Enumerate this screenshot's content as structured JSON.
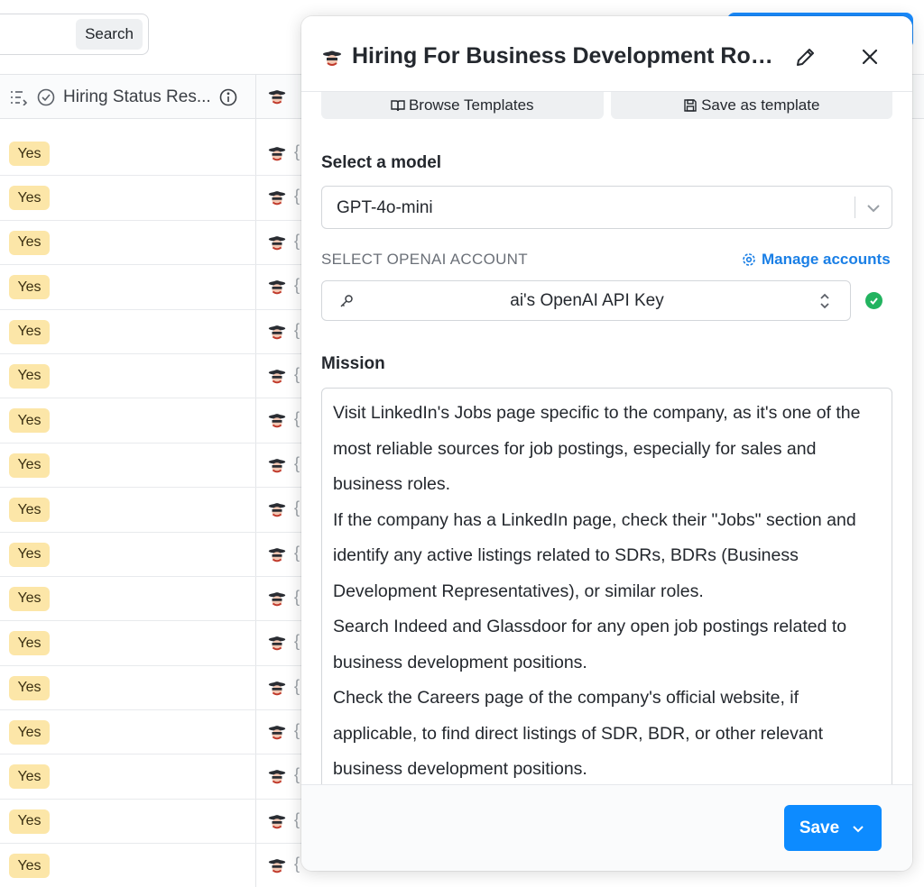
{
  "background": {
    "search_button_label": "Search",
    "column1_header": "Hiring Status Res...",
    "rows": [
      "Yes",
      "Yes",
      "Yes",
      "Yes",
      "Yes",
      "Yes",
      "Yes",
      "Yes",
      "Yes",
      "Yes",
      "Yes",
      "Yes",
      "Yes",
      "Yes",
      "Yes",
      "Yes",
      "Yes"
    ],
    "row_brace": "{",
    "colors": {
      "yes_badge_bg": "#fce6a8",
      "accent": "#1a8cff"
    }
  },
  "panel": {
    "title": "Hiring For Business Development Roles",
    "title_icon": "spy-agent-icon",
    "browse_templates_label": "Browse Templates",
    "save_template_label": "Save as template",
    "model_label": "Select a model",
    "model_value": "GPT-4o-mini",
    "account_label": "SELECT OPENAI ACCOUNT",
    "manage_accounts_label": "Manage accounts",
    "account_value": "ai's OpenAI API Key",
    "mission_label": "Mission",
    "mission_paragraphs": [
      "Visit LinkedIn's Jobs page specific to the company, as it's one of the most reliable sources for job postings, especially for sales and business roles.",
      "If the company has a LinkedIn page, check their \"Jobs\" section and identify any active listings related to SDRs, BDRs (Business Development Representatives), or similar roles.",
      "Search Indeed and Glassdoor for any open job postings related to business development positions.",
      "Check the Careers page of the company's official website, if applicable, to find direct listings of SDR, BDR, or other relevant business development positions."
    ],
    "save_label": "Save",
    "colors": {
      "save_bg": "#0d8bff",
      "link": "#1a7fe6",
      "status_ok": "#22b35f"
    }
  }
}
